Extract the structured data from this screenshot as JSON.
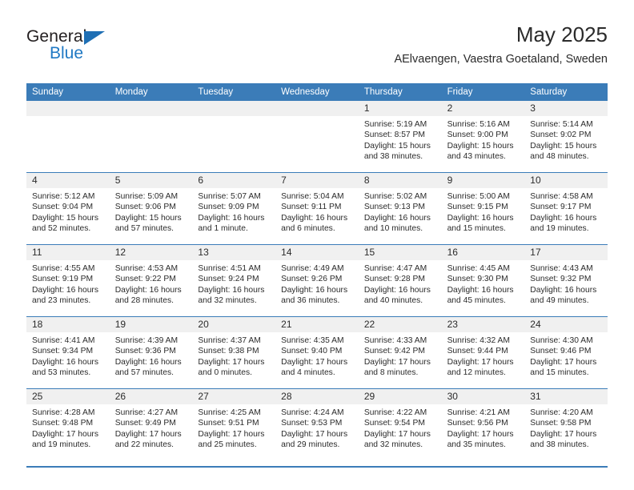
{
  "logo": {
    "name_top": "General",
    "name_bottom": "Blue",
    "triangle_icon": "blue-triangle-icon",
    "color_blue": "#2079c4",
    "color_dark": "#231f20"
  },
  "header": {
    "title": "May 2025",
    "subtitle": "AElvaengen, Vaestra Goetaland, Sweden"
  },
  "theme": {
    "header_bg": "#3b7cb8",
    "header_text": "#ffffff",
    "daynum_bg": "#f0f0f0",
    "cell_bg": "#ffffff",
    "rule": "#3b7cb8"
  },
  "weekdays": [
    "Sunday",
    "Monday",
    "Tuesday",
    "Wednesday",
    "Thursday",
    "Friday",
    "Saturday"
  ],
  "weeks": [
    [
      {
        "day": "",
        "sunrise": "",
        "sunset": "",
        "daylight_1": "",
        "daylight_2": ""
      },
      {
        "day": "",
        "sunrise": "",
        "sunset": "",
        "daylight_1": "",
        "daylight_2": ""
      },
      {
        "day": "",
        "sunrise": "",
        "sunset": "",
        "daylight_1": "",
        "daylight_2": ""
      },
      {
        "day": "",
        "sunrise": "",
        "sunset": "",
        "daylight_1": "",
        "daylight_2": ""
      },
      {
        "day": "1",
        "sunrise": "Sunrise: 5:19 AM",
        "sunset": "Sunset: 8:57 PM",
        "daylight_1": "Daylight: 15 hours",
        "daylight_2": "and 38 minutes."
      },
      {
        "day": "2",
        "sunrise": "Sunrise: 5:16 AM",
        "sunset": "Sunset: 9:00 PM",
        "daylight_1": "Daylight: 15 hours",
        "daylight_2": "and 43 minutes."
      },
      {
        "day": "3",
        "sunrise": "Sunrise: 5:14 AM",
        "sunset": "Sunset: 9:02 PM",
        "daylight_1": "Daylight: 15 hours",
        "daylight_2": "and 48 minutes."
      }
    ],
    [
      {
        "day": "4",
        "sunrise": "Sunrise: 5:12 AM",
        "sunset": "Sunset: 9:04 PM",
        "daylight_1": "Daylight: 15 hours",
        "daylight_2": "and 52 minutes."
      },
      {
        "day": "5",
        "sunrise": "Sunrise: 5:09 AM",
        "sunset": "Sunset: 9:06 PM",
        "daylight_1": "Daylight: 15 hours",
        "daylight_2": "and 57 minutes."
      },
      {
        "day": "6",
        "sunrise": "Sunrise: 5:07 AM",
        "sunset": "Sunset: 9:09 PM",
        "daylight_1": "Daylight: 16 hours",
        "daylight_2": "and 1 minute."
      },
      {
        "day": "7",
        "sunrise": "Sunrise: 5:04 AM",
        "sunset": "Sunset: 9:11 PM",
        "daylight_1": "Daylight: 16 hours",
        "daylight_2": "and 6 minutes."
      },
      {
        "day": "8",
        "sunrise": "Sunrise: 5:02 AM",
        "sunset": "Sunset: 9:13 PM",
        "daylight_1": "Daylight: 16 hours",
        "daylight_2": "and 10 minutes."
      },
      {
        "day": "9",
        "sunrise": "Sunrise: 5:00 AM",
        "sunset": "Sunset: 9:15 PM",
        "daylight_1": "Daylight: 16 hours",
        "daylight_2": "and 15 minutes."
      },
      {
        "day": "10",
        "sunrise": "Sunrise: 4:58 AM",
        "sunset": "Sunset: 9:17 PM",
        "daylight_1": "Daylight: 16 hours",
        "daylight_2": "and 19 minutes."
      }
    ],
    [
      {
        "day": "11",
        "sunrise": "Sunrise: 4:55 AM",
        "sunset": "Sunset: 9:19 PM",
        "daylight_1": "Daylight: 16 hours",
        "daylight_2": "and 23 minutes."
      },
      {
        "day": "12",
        "sunrise": "Sunrise: 4:53 AM",
        "sunset": "Sunset: 9:22 PM",
        "daylight_1": "Daylight: 16 hours",
        "daylight_2": "and 28 minutes."
      },
      {
        "day": "13",
        "sunrise": "Sunrise: 4:51 AM",
        "sunset": "Sunset: 9:24 PM",
        "daylight_1": "Daylight: 16 hours",
        "daylight_2": "and 32 minutes."
      },
      {
        "day": "14",
        "sunrise": "Sunrise: 4:49 AM",
        "sunset": "Sunset: 9:26 PM",
        "daylight_1": "Daylight: 16 hours",
        "daylight_2": "and 36 minutes."
      },
      {
        "day": "15",
        "sunrise": "Sunrise: 4:47 AM",
        "sunset": "Sunset: 9:28 PM",
        "daylight_1": "Daylight: 16 hours",
        "daylight_2": "and 40 minutes."
      },
      {
        "day": "16",
        "sunrise": "Sunrise: 4:45 AM",
        "sunset": "Sunset: 9:30 PM",
        "daylight_1": "Daylight: 16 hours",
        "daylight_2": "and 45 minutes."
      },
      {
        "day": "17",
        "sunrise": "Sunrise: 4:43 AM",
        "sunset": "Sunset: 9:32 PM",
        "daylight_1": "Daylight: 16 hours",
        "daylight_2": "and 49 minutes."
      }
    ],
    [
      {
        "day": "18",
        "sunrise": "Sunrise: 4:41 AM",
        "sunset": "Sunset: 9:34 PM",
        "daylight_1": "Daylight: 16 hours",
        "daylight_2": "and 53 minutes."
      },
      {
        "day": "19",
        "sunrise": "Sunrise: 4:39 AM",
        "sunset": "Sunset: 9:36 PM",
        "daylight_1": "Daylight: 16 hours",
        "daylight_2": "and 57 minutes."
      },
      {
        "day": "20",
        "sunrise": "Sunrise: 4:37 AM",
        "sunset": "Sunset: 9:38 PM",
        "daylight_1": "Daylight: 17 hours",
        "daylight_2": "and 0 minutes."
      },
      {
        "day": "21",
        "sunrise": "Sunrise: 4:35 AM",
        "sunset": "Sunset: 9:40 PM",
        "daylight_1": "Daylight: 17 hours",
        "daylight_2": "and 4 minutes."
      },
      {
        "day": "22",
        "sunrise": "Sunrise: 4:33 AM",
        "sunset": "Sunset: 9:42 PM",
        "daylight_1": "Daylight: 17 hours",
        "daylight_2": "and 8 minutes."
      },
      {
        "day": "23",
        "sunrise": "Sunrise: 4:32 AM",
        "sunset": "Sunset: 9:44 PM",
        "daylight_1": "Daylight: 17 hours",
        "daylight_2": "and 12 minutes."
      },
      {
        "day": "24",
        "sunrise": "Sunrise: 4:30 AM",
        "sunset": "Sunset: 9:46 PM",
        "daylight_1": "Daylight: 17 hours",
        "daylight_2": "and 15 minutes."
      }
    ],
    [
      {
        "day": "25",
        "sunrise": "Sunrise: 4:28 AM",
        "sunset": "Sunset: 9:48 PM",
        "daylight_1": "Daylight: 17 hours",
        "daylight_2": "and 19 minutes."
      },
      {
        "day": "26",
        "sunrise": "Sunrise: 4:27 AM",
        "sunset": "Sunset: 9:49 PM",
        "daylight_1": "Daylight: 17 hours",
        "daylight_2": "and 22 minutes."
      },
      {
        "day": "27",
        "sunrise": "Sunrise: 4:25 AM",
        "sunset": "Sunset: 9:51 PM",
        "daylight_1": "Daylight: 17 hours",
        "daylight_2": "and 25 minutes."
      },
      {
        "day": "28",
        "sunrise": "Sunrise: 4:24 AM",
        "sunset": "Sunset: 9:53 PM",
        "daylight_1": "Daylight: 17 hours",
        "daylight_2": "and 29 minutes."
      },
      {
        "day": "29",
        "sunrise": "Sunrise: 4:22 AM",
        "sunset": "Sunset: 9:54 PM",
        "daylight_1": "Daylight: 17 hours",
        "daylight_2": "and 32 minutes."
      },
      {
        "day": "30",
        "sunrise": "Sunrise: 4:21 AM",
        "sunset": "Sunset: 9:56 PM",
        "daylight_1": "Daylight: 17 hours",
        "daylight_2": "and 35 minutes."
      },
      {
        "day": "31",
        "sunrise": "Sunrise: 4:20 AM",
        "sunset": "Sunset: 9:58 PM",
        "daylight_1": "Daylight: 17 hours",
        "daylight_2": "and 38 minutes."
      }
    ]
  ]
}
